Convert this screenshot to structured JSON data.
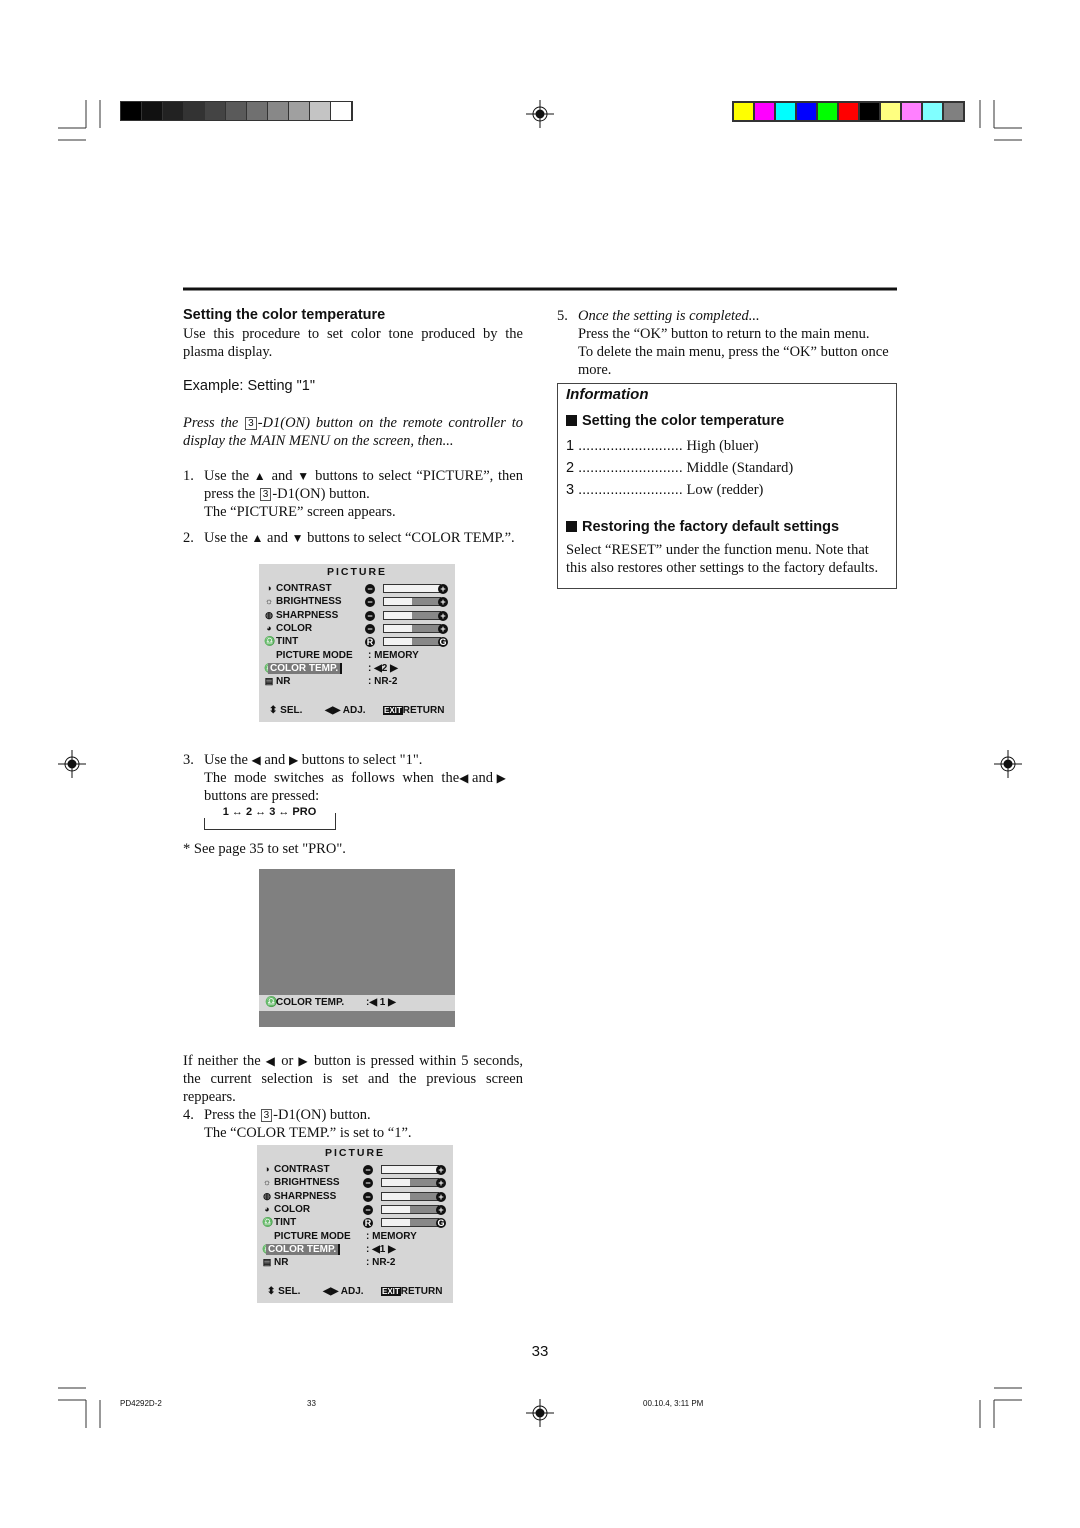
{
  "registration": {
    "gray_swatches": [
      "#000000",
      "#111111",
      "#222222",
      "#333333",
      "#444444",
      "#5a5a5a",
      "#707070",
      "#888888",
      "#a0a0a0",
      "#c4c4c4",
      "#ffffff"
    ],
    "color_swatches": [
      "#ffff00",
      "#ff00ff",
      "#00ffff",
      "#0000ff",
      "#00ff00",
      "#ff0000",
      "#000000",
      "#ffff80",
      "#ff80ff",
      "#80ffff",
      "#808080"
    ]
  },
  "left": {
    "heading": "Setting the color temperature",
    "intro": "Use this procedure to set color tone produced by the plasma display.",
    "example": "Example: Setting \"1\"",
    "press_a": "Press the",
    "key": "3",
    "press_b": "-D1(ON) button on the remote controller to display the MAIN MENU on the screen, then...",
    "step1": {
      "n": "1.",
      "a": "Use the",
      "up": "▲",
      "and": "and",
      "down": "▼",
      "b": "buttons to select “PICTURE”, then press the",
      "key": "3",
      "c": "-D1(ON) button.",
      "d": "The “PICTURE” screen appears."
    },
    "step2": {
      "n": "2.",
      "a": "Use the",
      "up": "▲",
      "and": "and",
      "down": "▼",
      "b": "buttons to select “COLOR TEMP.”."
    },
    "step3": {
      "n": "3.",
      "a": "Use the",
      "left": "◀",
      "and": "and",
      "right": "▶",
      "b": "buttons to select \"1\".",
      "c": "The mode switches as follows when the",
      "d": "buttons are pressed:"
    },
    "cycle": "1 ↔ 2 ↔ 3 ↔ PRO",
    "note": "* See page 35 to set \"PRO\".",
    "timeout": {
      "a": "If neither the",
      "left": "◀",
      "or": "or",
      "right": "▶",
      "b": "button is pressed within 5 seconds, the current selection is set and the previous screen reppears."
    },
    "step4": {
      "n": "4.",
      "a": "Press the",
      "key": "3",
      "b": "-D1(ON) button.",
      "c": "The “COLOR TEMP.” is set to “1”."
    }
  },
  "osd1": {
    "title": "PICTURE",
    "rows": [
      {
        "icon": "◑",
        "label": "CONTRAST",
        "type": "bar",
        "level": 1.0,
        "minus": "−",
        "plus": "+"
      },
      {
        "icon": "☼",
        "label": "BRIGHTNESS",
        "type": "bar",
        "level": 0.5,
        "minus": "−",
        "plus": "+"
      },
      {
        "icon": "◍",
        "label": "SHARPNESS",
        "type": "bar",
        "level": 0.5,
        "minus": "−",
        "plus": "+"
      },
      {
        "icon": "◕",
        "label": "COLOR",
        "type": "bar",
        "level": 0.5,
        "minus": "−",
        "plus": "+"
      },
      {
        "icon": "♎",
        "label": "TINT",
        "type": "bar",
        "level": 0.5,
        "minus": "R",
        "plus": "G"
      },
      {
        "icon": "",
        "label": "PICTURE MODE",
        "type": "value",
        "value": ":   MEMORY"
      },
      {
        "icon": "♎",
        "label": "COLOR TEMP.",
        "type": "value",
        "value": ": ◀2 ▶",
        "selected": true
      },
      {
        "icon": "▤",
        "label": "NR",
        "type": "value",
        "value": ":   NR-2"
      }
    ],
    "footer": {
      "sel": "⬍ SEL.",
      "adj": "◀▶ ADJ.",
      "exit": "EXIT",
      "ret": "RETURN"
    }
  },
  "osd2": {
    "title": "PICTURE",
    "rows": [
      {
        "icon": "◑",
        "label": "CONTRAST",
        "type": "bar",
        "level": 1.0,
        "minus": "−",
        "plus": "+"
      },
      {
        "icon": "☼",
        "label": "BRIGHTNESS",
        "type": "bar",
        "level": 0.5,
        "minus": "−",
        "plus": "+"
      },
      {
        "icon": "◍",
        "label": "SHARPNESS",
        "type": "bar",
        "level": 0.5,
        "minus": "−",
        "plus": "+"
      },
      {
        "icon": "◕",
        "label": "COLOR",
        "type": "bar",
        "level": 0.5,
        "minus": "−",
        "plus": "+"
      },
      {
        "icon": "♎",
        "label": "TINT",
        "type": "bar",
        "level": 0.5,
        "minus": "R",
        "plus": "G"
      },
      {
        "icon": "",
        "label": "PICTURE MODE",
        "type": "value",
        "value": ":   MEMORY"
      },
      {
        "icon": "♎",
        "label": "COLOR TEMP.",
        "type": "value",
        "value": ": ◀1 ▶",
        "selected": true
      },
      {
        "icon": "▤",
        "label": "NR",
        "type": "value",
        "value": ":   NR-2"
      }
    ],
    "footer": {
      "sel": "⬍ SEL.",
      "adj": "◀▶ ADJ.",
      "exit": "EXIT",
      "ret": "RETURN"
    }
  },
  "screen": {
    "icon": "♎",
    "label": "COLOR TEMP.",
    "value": ":◀  1   ▶"
  },
  "right": {
    "step5": {
      "n": "5.",
      "a": "Once the setting is completed...",
      "b": "Press the “OK” button to return to the main menu.",
      "c": "To delete the main menu, press the “OK” button once more."
    },
    "info": {
      "title": "Information",
      "sec1": "Setting the color temperature",
      "items": [
        {
          "k": "1 ..........................",
          "v": "High (bluer)"
        },
        {
          "k": "2 ..........................",
          "v": "Middle (Standard)"
        },
        {
          "k": "3 ..........................",
          "v": "Low (redder)"
        }
      ],
      "sec2": "Restoring the factory default settings",
      "sec2_text": "Select “RESET” under the function menu. Note that this also restores other settings to the factory defaults."
    }
  },
  "page_number": "33",
  "footer": {
    "doc": "PD4292D-2",
    "page": "33",
    "timestamp": "00.10.4, 3:11 PM"
  }
}
